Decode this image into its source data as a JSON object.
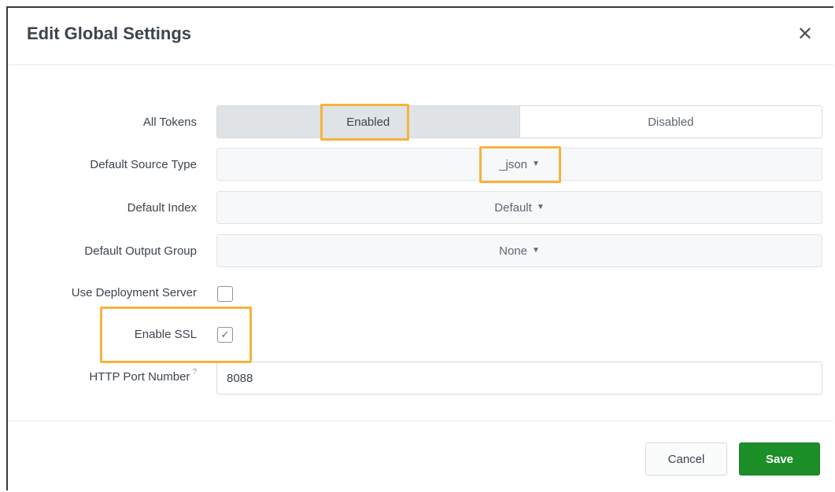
{
  "dialog": {
    "title": "Edit Global Settings",
    "close_icon": "close-icon"
  },
  "form": {
    "all_tokens": {
      "label": "All Tokens",
      "options": [
        "Enabled",
        "Disabled"
      ],
      "selected": "Enabled"
    },
    "default_source_type": {
      "label": "Default Source Type",
      "value": "_json"
    },
    "default_index": {
      "label": "Default Index",
      "value": "Default"
    },
    "default_output_group": {
      "label": "Default Output Group",
      "value": "None"
    },
    "use_deployment_server": {
      "label": "Use Deployment Server",
      "checked": false
    },
    "enable_ssl": {
      "label": "Enable SSL",
      "checked": true,
      "check_glyph": "✓"
    },
    "http_port_number": {
      "label": "HTTP Port Number",
      "help_mark": "?",
      "value": "8088"
    }
  },
  "footer": {
    "cancel_label": "Cancel",
    "save_label": "Save"
  },
  "colors": {
    "highlight": "#f4b43c",
    "primary_button": "#1c8f28",
    "selected_toggle": "#dfe3e6"
  }
}
